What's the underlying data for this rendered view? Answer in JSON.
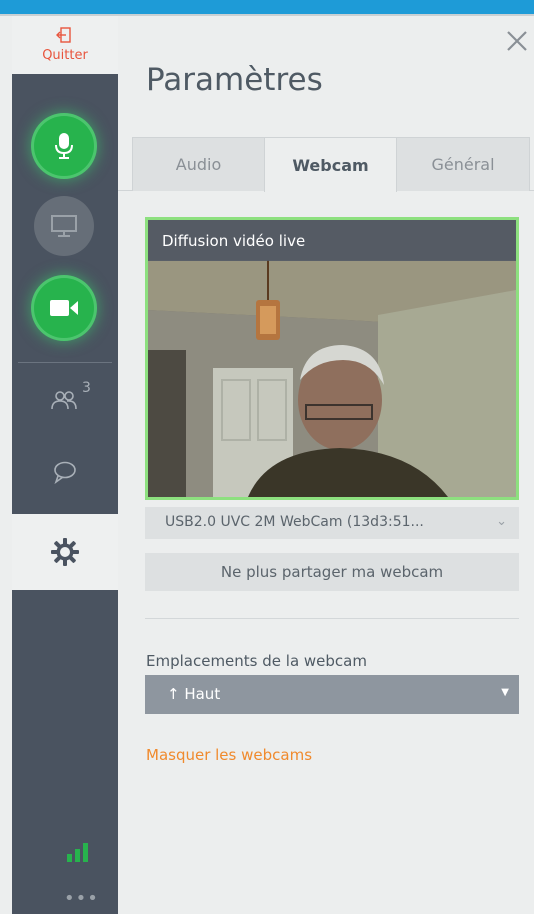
{
  "sidebar": {
    "quit_label": "Quitter",
    "participants_count": "3",
    "accent_green": "#27b34d",
    "items": [
      {
        "name": "microphone",
        "state": "active"
      },
      {
        "name": "screen-share",
        "state": "inactive"
      },
      {
        "name": "webcam",
        "state": "active"
      },
      {
        "name": "participants"
      },
      {
        "name": "chat"
      },
      {
        "name": "settings",
        "state": "selected"
      }
    ]
  },
  "panel": {
    "title": "Paramètres",
    "tabs": [
      {
        "label": "Audio",
        "active": false
      },
      {
        "label": "Webcam",
        "active": true
      },
      {
        "label": "Général",
        "active": false
      }
    ],
    "video_label": "Diffusion vidéo live",
    "camera_select": "USB2.0 UVC 2M WebCam (13d3:51...",
    "stop_share_label": "Ne plus partager ma webcam",
    "location_label": "Emplacements de la webcam",
    "location_value": "↑ Haut",
    "hide_webcams_label": "Masquer les webcams"
  }
}
